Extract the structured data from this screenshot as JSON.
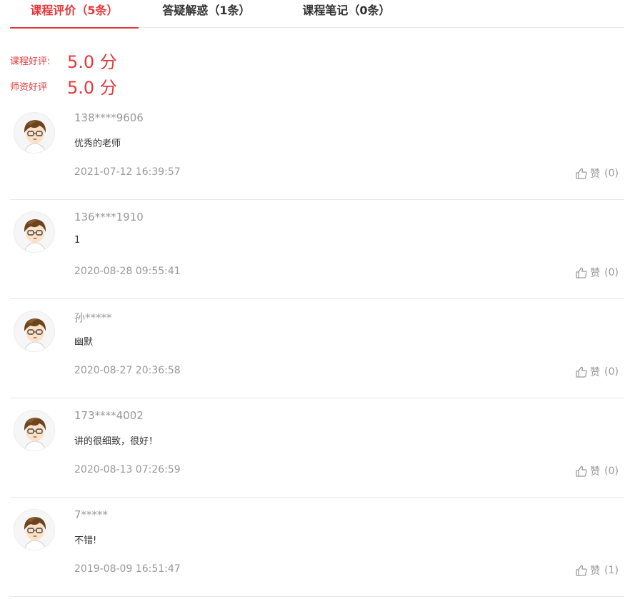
{
  "tabs": [
    {
      "label": "课程评价（5条）",
      "active": true
    },
    {
      "label": "答疑解惑（1条）",
      "active": false
    },
    {
      "label": "课程笔记（0条）",
      "active": false
    }
  ],
  "ratings": [
    {
      "label": "课程好评:",
      "value": "5.0 分"
    },
    {
      "label": "师资好评",
      "value": "5.0 分"
    }
  ],
  "like_label": "赞",
  "accent_color": "#e4393c",
  "comments": [
    {
      "user": "138****9606",
      "content": "优秀的老师",
      "time": "2021-07-12 16:39:57",
      "likes": "(0)"
    },
    {
      "user": "136****1910",
      "content": "1",
      "time": "2020-08-28 09:55:41",
      "likes": "(0)"
    },
    {
      "user": "孙*****",
      "content": "幽默",
      "time": "2020-08-27 20:36:58",
      "likes": "(0)"
    },
    {
      "user": "173****4002",
      "content": "讲的很细致，很好！",
      "time": "2020-08-13 07:26:59",
      "likes": "(0)"
    },
    {
      "user": "7*****",
      "content": "不错!",
      "time": "2019-08-09 16:51:47",
      "likes": "(1)"
    }
  ]
}
